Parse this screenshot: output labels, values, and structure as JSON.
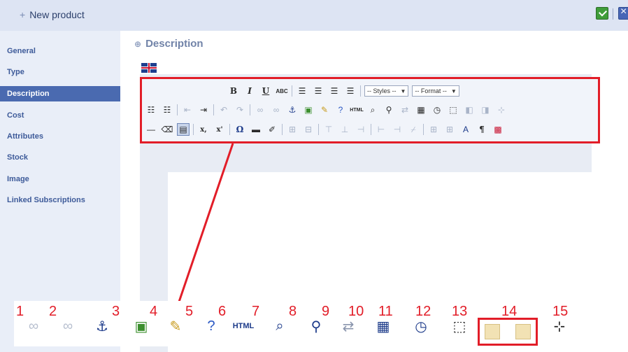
{
  "header": {
    "plus": "+",
    "title": "New product"
  },
  "sidebar": {
    "items": [
      {
        "label": "General"
      },
      {
        "label": "Type"
      },
      {
        "label": "Description",
        "active": true
      },
      {
        "label": "Cost"
      },
      {
        "label": "Attributes"
      },
      {
        "label": "Stock"
      },
      {
        "label": "Image"
      },
      {
        "label": "Linked Subscriptions"
      }
    ]
  },
  "main": {
    "bullet": "⊕",
    "section_title": "Description",
    "language_flag": "uk-flag-icon",
    "toolbar": {
      "bold": "B",
      "italic": "I",
      "underline": "U",
      "strikethrough": "ABC",
      "styles_select": "-- Styles --",
      "format_select": "-- Format --",
      "html_label": "HTML",
      "omega": "Ω",
      "pilcrow": "¶",
      "subscript": "x,",
      "superscript": "x'"
    }
  },
  "zoom": {
    "numbers": [
      "1",
      "2",
      "3",
      "4",
      "5",
      "6",
      "7",
      "8",
      "9",
      "10",
      "11",
      "12",
      "13",
      "14",
      "15"
    ],
    "html_label": "HTML"
  },
  "colors": {
    "highlight": "#e21d28",
    "sidebar_active": "#4a6ab0",
    "header_bg": "#dde4f3"
  }
}
